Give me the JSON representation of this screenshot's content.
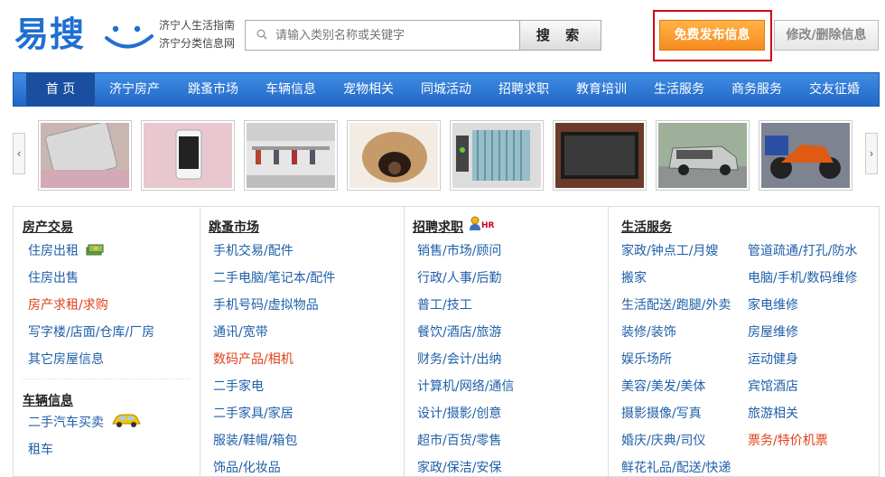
{
  "header": {
    "logo_text": "易搜",
    "slogan_line1": "济宁人生活指南",
    "slogan_line2": "济宁分类信息网",
    "search_placeholder": "请输入类别名称或关键字",
    "search_button": "搜 索",
    "post_button": "免费发布信息",
    "edit_button": "修改/删除信息"
  },
  "nav": {
    "items": [
      "首 页",
      "济宁房产",
      "跳蚤市场",
      "车辆信息",
      "宠物相关",
      "同城活动",
      "招聘求职",
      "教育培训",
      "生活服务",
      "商务服务",
      "交友征婚"
    ]
  },
  "carousel": {
    "prev": "‹",
    "next": "›",
    "images": [
      {
        "icon": "tablet-photo",
        "color": "#c9b6b0"
      },
      {
        "icon": "phone-photo",
        "color": "#e8c7cf"
      },
      {
        "icon": "store-photo",
        "color": "#d9d9d9"
      },
      {
        "icon": "pet-bed-photo",
        "color": "#c79a6a"
      },
      {
        "icon": "bird-cage-photo",
        "color": "#6aa9b8"
      },
      {
        "icon": "tv-photo",
        "color": "#6b3b2a"
      },
      {
        "icon": "van-photo",
        "color": "#9aa6a3"
      },
      {
        "icon": "motorbike-photo",
        "color": "#59616e"
      }
    ]
  },
  "columns": {
    "realestate": {
      "title": "房产交易",
      "items": [
        {
          "label": "住房出租",
          "red": false
        },
        {
          "label": "住房出售",
          "red": false
        },
        {
          "label": "房产求租/求购",
          "red": true
        },
        {
          "label": "写字楼/店面/仓库/厂房",
          "red": false
        },
        {
          "label": "其它房屋信息",
          "red": false
        }
      ]
    },
    "vehicle": {
      "title": "车辆信息",
      "items": [
        {
          "label": "二手汽车买卖",
          "red": false
        },
        {
          "label": "租车",
          "red": false
        }
      ]
    },
    "flea": {
      "title": "跳蚤市场",
      "items": [
        {
          "label": "手机交易/配件",
          "red": false
        },
        {
          "label": "二手电脑/笔记本/配件",
          "red": false
        },
        {
          "label": "手机号码/虚拟物品",
          "red": false
        },
        {
          "label": "通讯/宽带",
          "red": false
        },
        {
          "label": "数码产品/相机",
          "red": true
        },
        {
          "label": "二手家电",
          "red": false
        },
        {
          "label": "二手家具/家居",
          "red": false
        },
        {
          "label": "服装/鞋帽/箱包",
          "red": false
        },
        {
          "label": "饰品/化妆品",
          "red": false
        }
      ]
    },
    "jobs": {
      "title": "招聘求职",
      "badge": "HR",
      "items": [
        {
          "label": "销售/市场/顾问",
          "red": false
        },
        {
          "label": "行政/人事/后勤",
          "red": false
        },
        {
          "label": "普工/技工",
          "red": false
        },
        {
          "label": "餐饮/酒店/旅游",
          "red": false
        },
        {
          "label": "财务/会计/出纳",
          "red": false
        },
        {
          "label": "计算机/网络/通信",
          "red": false
        },
        {
          "label": "设计/摄影/创意",
          "red": false
        },
        {
          "label": "超市/百货/零售",
          "red": false
        },
        {
          "label": "家政/保洁/安保",
          "red": false
        }
      ]
    },
    "life": {
      "title": "生活服务",
      "left": [
        {
          "label": "家政/钟点工/月嫂",
          "red": false
        },
        {
          "label": "搬家",
          "red": false
        },
        {
          "label": "生活配送/跑腿/外卖",
          "red": false
        },
        {
          "label": "装修/装饰",
          "red": false
        },
        {
          "label": "娱乐场所",
          "red": false
        },
        {
          "label": "美容/美发/美体",
          "red": false
        },
        {
          "label": "摄影摄像/写真",
          "red": false
        },
        {
          "label": "婚庆/庆典/司仪",
          "red": false
        },
        {
          "label": "鲜花礼品/配送/快递",
          "red": false
        }
      ],
      "right": [
        {
          "label": "管道疏通/打孔/防水",
          "red": false
        },
        {
          "label": "电脑/手机/数码维修",
          "red": false
        },
        {
          "label": "家电维修",
          "red": false
        },
        {
          "label": "房屋维修",
          "red": false
        },
        {
          "label": "运动健身",
          "red": false
        },
        {
          "label": "宾馆酒店",
          "red": false
        },
        {
          "label": "旅游相关",
          "red": false
        },
        {
          "label": "票务/特价机票",
          "red": true
        }
      ]
    }
  },
  "colors": {
    "brand_blue": "#1f6fd1",
    "nav_blue": "#2f7ad6",
    "link_blue": "#1f5fa8",
    "accent_red": "#e0401a",
    "post_orange": "#f58a1f"
  }
}
